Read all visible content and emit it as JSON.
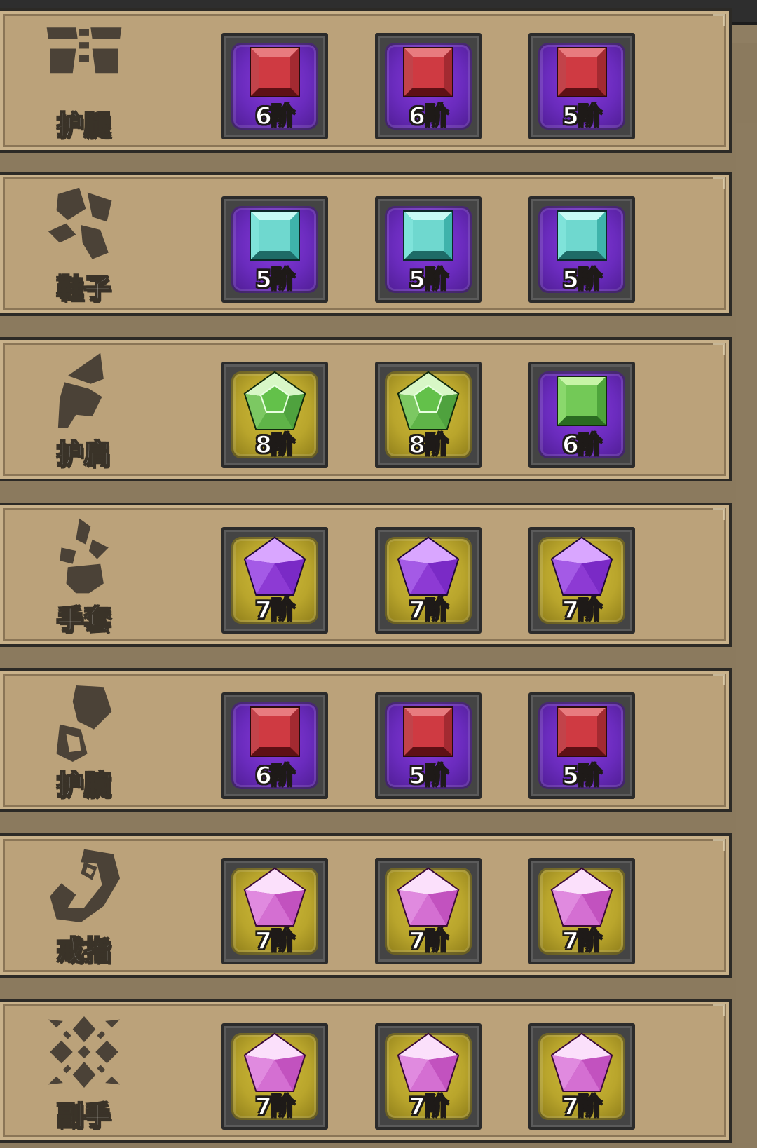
{
  "colors": {
    "frame_purple": "#6a2bbd",
    "frame_gold": "#b9a52c",
    "panel": "#bba27a",
    "icon": "#4b4237"
  },
  "rows": [
    {
      "label": "护腿",
      "icon": "leggings-icon",
      "gems": [
        {
          "tier": "6阶",
          "gem": "red-square",
          "frame": "purple"
        },
        {
          "tier": "6阶",
          "gem": "red-square",
          "frame": "purple"
        },
        {
          "tier": "5阶",
          "gem": "red-square",
          "frame": "purple"
        }
      ]
    },
    {
      "label": "鞋子",
      "icon": "boots-icon",
      "gems": [
        {
          "tier": "5阶",
          "gem": "teal-square",
          "frame": "purple"
        },
        {
          "tier": "5阶",
          "gem": "teal-square",
          "frame": "purple"
        },
        {
          "tier": "5阶",
          "gem": "teal-square",
          "frame": "purple"
        }
      ]
    },
    {
      "label": "护肩",
      "icon": "shoulder-icon",
      "gems": [
        {
          "tier": "8阶",
          "gem": "green-pentagon",
          "frame": "gold"
        },
        {
          "tier": "8阶",
          "gem": "green-pentagon",
          "frame": "gold"
        },
        {
          "tier": "6阶",
          "gem": "green-square",
          "frame": "purple"
        }
      ]
    },
    {
      "label": "手套",
      "icon": "gloves-icon",
      "gems": [
        {
          "tier": "7阶",
          "gem": "purple-pentagon",
          "frame": "gold"
        },
        {
          "tier": "7阶",
          "gem": "purple-pentagon",
          "frame": "gold"
        },
        {
          "tier": "7阶",
          "gem": "purple-pentagon",
          "frame": "gold"
        }
      ]
    },
    {
      "label": "护腕",
      "icon": "bracer-icon",
      "gems": [
        {
          "tier": "6阶",
          "gem": "red-square",
          "frame": "purple"
        },
        {
          "tier": "5阶",
          "gem": "red-square",
          "frame": "purple"
        },
        {
          "tier": "5阶",
          "gem": "red-square",
          "frame": "purple"
        }
      ]
    },
    {
      "label": "戒指",
      "icon": "ring-icon",
      "gems": [
        {
          "tier": "7阶",
          "gem": "pink-pentagon",
          "frame": "gold"
        },
        {
          "tier": "7阶",
          "gem": "pink-pentagon",
          "frame": "gold"
        },
        {
          "tier": "7阶",
          "gem": "pink-pentagon",
          "frame": "gold"
        }
      ]
    },
    {
      "label": "副手",
      "icon": "offhand-icon",
      "gems": [
        {
          "tier": "7阶",
          "gem": "pink-pentagon",
          "frame": "gold"
        },
        {
          "tier": "7阶",
          "gem": "pink-pentagon",
          "frame": "gold"
        },
        {
          "tier": "7阶",
          "gem": "pink-pentagon",
          "frame": "gold"
        }
      ]
    }
  ]
}
